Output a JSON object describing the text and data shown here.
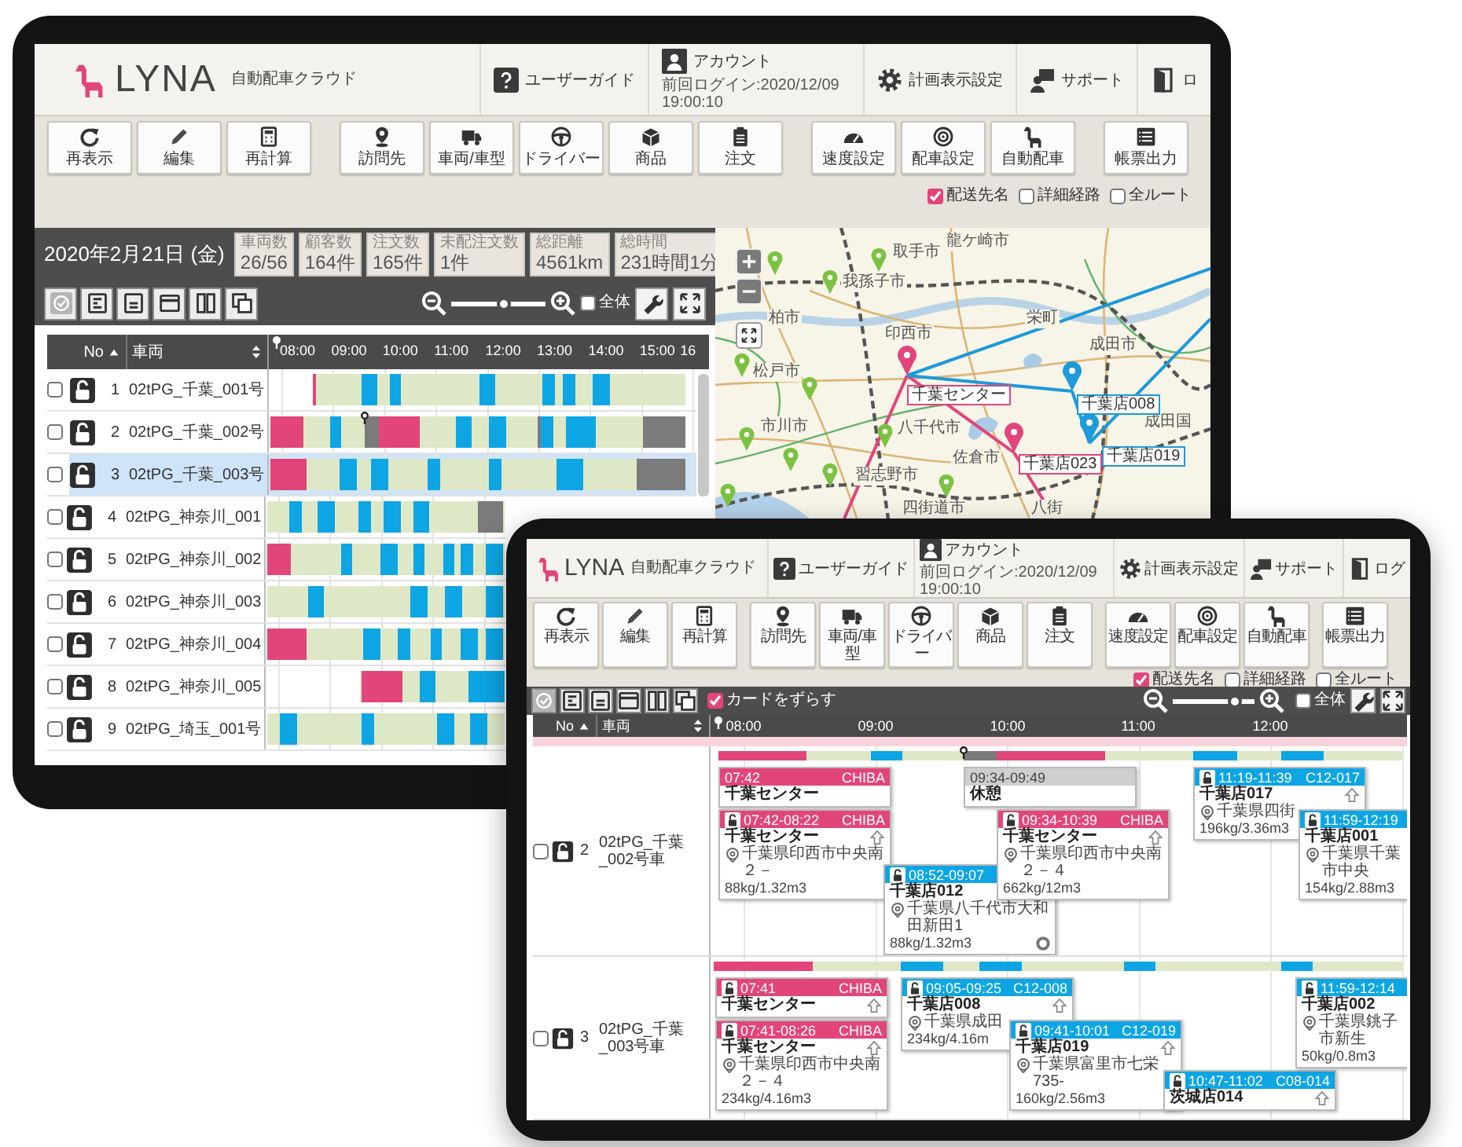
{
  "back_tablet": {
    "header": {
      "logo": "LYNA",
      "app_name": "自動配車クラウド",
      "nav": [
        {
          "label": "ユーザーガイド"
        },
        {
          "label": "アカウント",
          "last_login": "前回ログイン:2020/12/09 19:00:10"
        },
        {
          "label": "計画表示設定"
        },
        {
          "label": "サポート"
        },
        {
          "label": "ロ"
        }
      ]
    },
    "toolbar": [
      [
        {
          "label": "再表示"
        },
        {
          "label": "編集"
        },
        {
          "label": "再計算"
        }
      ],
      [
        {
          "label": "訪問先"
        },
        {
          "label": "車両/車型"
        },
        {
          "label": "ドライバー"
        },
        {
          "label": "商品"
        },
        {
          "label": "注文"
        }
      ],
      [
        {
          "label": "速度設定"
        },
        {
          "label": "配車設定"
        },
        {
          "label": "自動配車"
        }
      ],
      [
        {
          "label": "帳票出力"
        }
      ]
    ],
    "map_options": [
      {
        "label": "配送先名",
        "checked": true
      },
      {
        "label": "詳細経路",
        "checked": false
      },
      {
        "label": "全ルート",
        "checked": false
      }
    ],
    "plan": {
      "date": "2020年2月21日 (金)",
      "stats": [
        {
          "label": "車両数",
          "value": "26/56"
        },
        {
          "label": "顧客数",
          "value": "164件"
        },
        {
          "label": "注文数",
          "value": "165件"
        },
        {
          "label": "未配注文数",
          "value": "1件"
        },
        {
          "label": "総距離",
          "value": "4561km"
        },
        {
          "label": "総時間",
          "value": "231時間1分"
        }
      ],
      "zoom": {
        "level": 0.55
      },
      "show_all": {
        "label": "全体",
        "checked": false
      }
    },
    "table": {
      "columns": [
        {
          "label": "No",
          "sorted": true
        },
        {
          "label": "車両",
          "sorted": false
        }
      ],
      "time_ticks": [
        "08:00",
        "09:00",
        "10:00",
        "11:00",
        "12:00",
        "13:00",
        "14:00",
        "15:00",
        "16"
      ],
      "rows": [
        {
          "no": "1",
          "vehicle": "02tPG_千葉_001号",
          "checked": false,
          "selected": false
        },
        {
          "no": "2",
          "vehicle": "02tPG_千葉_002号",
          "checked": false,
          "selected": false
        },
        {
          "no": "3",
          "vehicle": "02tPG_千葉_003号",
          "checked": false,
          "selected": true
        },
        {
          "no": "4",
          "vehicle": "02tPG_神奈川_001",
          "checked": false,
          "selected": false
        },
        {
          "no": "5",
          "vehicle": "02tPG_神奈川_002",
          "checked": false,
          "selected": false
        },
        {
          "no": "6",
          "vehicle": "02tPG_神奈川_003",
          "checked": false,
          "selected": false
        },
        {
          "no": "7",
          "vehicle": "02tPG_神奈川_004",
          "checked": false,
          "selected": false
        },
        {
          "no": "8",
          "vehicle": "02tPG_神奈川_005",
          "checked": false,
          "selected": false
        },
        {
          "no": "9",
          "vehicle": "02tPG_埼玉_001号",
          "checked": false,
          "selected": false
        }
      ]
    },
    "map": {
      "places": [
        {
          "name": "取手市"
        },
        {
          "name": "龍ケ崎市"
        },
        {
          "name": "我孫子市"
        },
        {
          "name": "柏市"
        },
        {
          "name": "栄町"
        },
        {
          "name": "印西市"
        },
        {
          "name": "成田市"
        },
        {
          "name": "松戸市"
        },
        {
          "name": "市川市"
        },
        {
          "name": "八千代市"
        },
        {
          "name": "成田国"
        },
        {
          "name": "佐倉市"
        },
        {
          "name": "習志野市"
        },
        {
          "name": "四街道市"
        },
        {
          "name": "八街"
        }
      ],
      "stops": [
        {
          "label": "千葉センター",
          "color": "#e2457a"
        },
        {
          "label": "千葉店008",
          "color": "#1c9ad9"
        },
        {
          "label": "千葉店019",
          "color": "#1c9ad9"
        },
        {
          "label": "千葉店023",
          "color": "#e2457a"
        }
      ]
    }
  },
  "front_tablet": {
    "header": {
      "logo": "LYNA",
      "app_name": "自動配車クラウド",
      "nav": [
        {
          "label": "ユーザーガイド"
        },
        {
          "label": "アカウント",
          "last_login": "前回ログイン:2020/12/09 19:00:10"
        },
        {
          "label": "計画表示設定"
        },
        {
          "label": "サポート"
        },
        {
          "label": "ログ"
        }
      ]
    },
    "toolbar": [
      [
        {
          "label": "再表示"
        },
        {
          "label": "編集"
        },
        {
          "label": "再計算"
        }
      ],
      [
        {
          "label": "訪問先"
        },
        {
          "label": "車両/車型"
        },
        {
          "label": "ドライバー"
        },
        {
          "label": "商品"
        },
        {
          "label": "注文"
        }
      ],
      [
        {
          "label": "速度設定"
        },
        {
          "label": "配車設定"
        },
        {
          "label": "自動配車"
        }
      ],
      [
        {
          "label": "帳票出力"
        }
      ]
    ],
    "map_options": [
      {
        "label": "配送先名",
        "checked": true
      },
      {
        "label": "詳細経路",
        "checked": false
      },
      {
        "label": "全ルート",
        "checked": false
      }
    ],
    "plan": {
      "shift_cards": {
        "label": "カードをずらす",
        "checked": true
      },
      "zoom": {
        "level": 0.75
      },
      "show_all": {
        "label": "全体",
        "checked": false
      }
    },
    "table": {
      "columns": [
        {
          "label": "No",
          "sorted": true
        },
        {
          "label": "車両",
          "sorted": false
        }
      ],
      "time_ticks": [
        "08:00",
        "09:00",
        "10:00",
        "11:00",
        "12:00"
      ],
      "rows": [
        {
          "no": "2",
          "vehicle": "02tPG_千葉_002号車",
          "checked": false,
          "cards": [
            {
              "kind": "depot",
              "locked": false,
              "time": "07:42",
              "code": "CHIBA",
              "title": "千葉センター",
              "up_arrow": false,
              "end_icon": false
            },
            {
              "kind": "break",
              "locked": false,
              "time": "09:34-09:49",
              "title": "休憩",
              "up_arrow": false,
              "end_icon": false
            },
            {
              "kind": "depot",
              "locked": true,
              "time": "07:42-08:22",
              "code": "CHIBA",
              "title": "千葉センター",
              "up_arrow": true,
              "address": "千葉県印西市中央南２－",
              "load": "88kg/1.32m3",
              "end_icon": false
            },
            {
              "kind": "stop",
              "locked": true,
              "time": "08:52-09:07",
              "title": "千葉店012",
              "up_arrow": false,
              "address": "千葉県八千代市大和田新田1",
              "load": "88kg/1.32m3",
              "end_icon": true
            },
            {
              "kind": "depot",
              "locked": true,
              "time": "09:34-10:39",
              "code": "CHIBA",
              "title": "千葉センター",
              "up_arrow": true,
              "address": "千葉県印西市中央南２－４",
              "load": "662kg/12m3",
              "end_icon": false
            },
            {
              "kind": "stop",
              "locked": true,
              "time": "11:19-11:39",
              "code": "C12-017",
              "title": "千葉店017",
              "up_arrow": true,
              "address": "千葉県四街",
              "load": "196kg/3.36m3",
              "end_icon": false
            },
            {
              "kind": "stop",
              "locked": true,
              "time": "11:59-12:19",
              "title": "千葉店001",
              "up_arrow": false,
              "address": "千葉県千葉市中央",
              "load": "154kg/2.88m3",
              "end_icon": false
            }
          ]
        },
        {
          "no": "3",
          "vehicle": "02tPG_千葉_003号車",
          "checked": false,
          "cards": [
            {
              "kind": "depot",
              "locked": true,
              "time": "07:41",
              "code": "CHIBA",
              "title": "千葉センター",
              "up_arrow": true,
              "end_icon": false
            },
            {
              "kind": "depot",
              "locked": true,
              "time": "07:41-08:26",
              "code": "CHIBA",
              "title": "千葉センター",
              "up_arrow": true,
              "address": "千葉県印西市中央南２－４",
              "load": "234kg/4.16m3",
              "end_icon": false
            },
            {
              "kind": "stop",
              "locked": true,
              "time": "09:05-09:25",
              "code": "C12-008",
              "title": "千葉店008",
              "up_arrow": true,
              "address": "千葉県成田",
              "load": "234kg/4.16m",
              "end_icon": false
            },
            {
              "kind": "stop",
              "locked": true,
              "time": "09:41-10:01",
              "code": "C12-019",
              "title": "千葉店019",
              "up_arrow": true,
              "address": "千葉県富里市七栄735-",
              "load": "160kg/2.56m3",
              "end_icon": false
            },
            {
              "kind": "stop",
              "locked": true,
              "time": "10:47-11:02",
              "code": "C08-014",
              "title": "茨城店014",
              "up_arrow": true,
              "end_icon": false
            },
            {
              "kind": "stop",
              "locked": true,
              "time": "11:59-12:14",
              "title": "千葉店002",
              "up_arrow": false,
              "address": "千葉県銚子市新生",
              "load": "50kg/0.8m3",
              "end_icon": false
            }
          ]
        }
      ]
    }
  }
}
